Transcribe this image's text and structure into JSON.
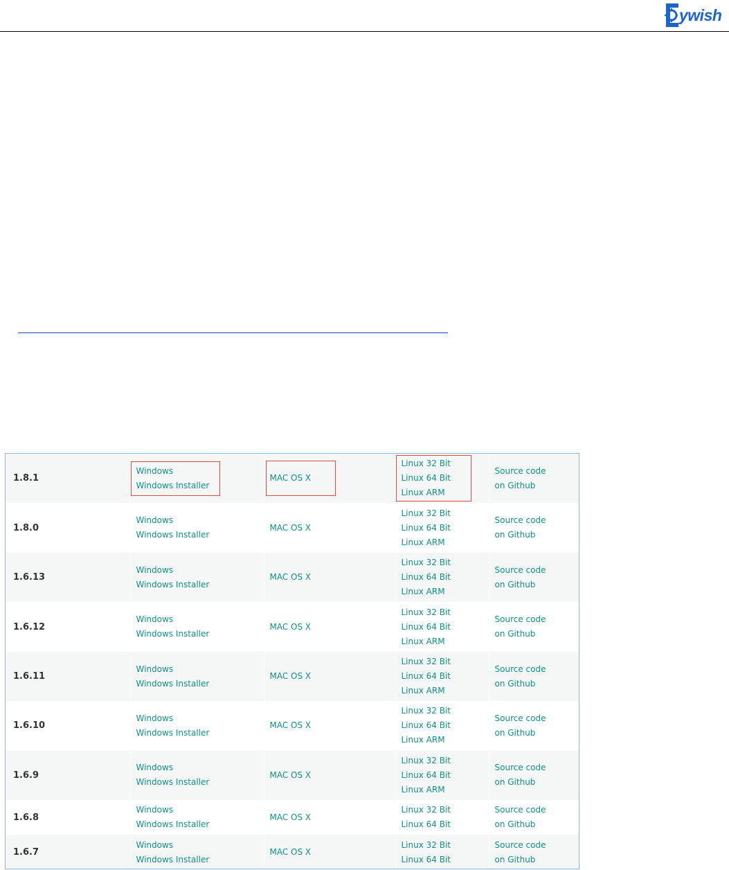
{
  "logo": {
    "text": "ywish"
  },
  "releases": [
    {
      "version": "1.8.1",
      "windows": [
        "Windows",
        "Windows Installer"
      ],
      "mac": "MAC OS X",
      "linux": [
        "Linux 32 Bit",
        "Linux 64 Bit",
        "Linux ARM"
      ],
      "source": [
        "Source code",
        "on Github"
      ]
    },
    {
      "version": "1.8.0",
      "windows": [
        "Windows",
        "Windows Installer"
      ],
      "mac": "MAC OS X",
      "linux": [
        "Linux 32 Bit",
        "Linux 64 Bit",
        "Linux ARM"
      ],
      "source": [
        "Source code",
        "on Github"
      ]
    },
    {
      "version": "1.6.13",
      "windows": [
        "Windows",
        "Windows Installer"
      ],
      "mac": "MAC OS X",
      "linux": [
        "Linux 32 Bit",
        "Linux 64 Bit",
        "Linux ARM"
      ],
      "source": [
        "Source code",
        "on Github"
      ]
    },
    {
      "version": "1.6.12",
      "windows": [
        "Windows",
        "Windows Installer"
      ],
      "mac": "MAC OS X",
      "linux": [
        "Linux 32 Bit",
        "Linux 64 Bit",
        "Linux ARM"
      ],
      "source": [
        "Source code",
        "on Github"
      ]
    },
    {
      "version": "1.6.11",
      "windows": [
        "Windows",
        "Windows Installer"
      ],
      "mac": "MAC OS X",
      "linux": [
        "Linux 32 Bit",
        "Linux 64 Bit",
        "Linux ARM"
      ],
      "source": [
        "Source code",
        "on Github"
      ]
    },
    {
      "version": "1.6.10",
      "windows": [
        "Windows",
        "Windows Installer"
      ],
      "mac": "MAC OS X",
      "linux": [
        "Linux 32 Bit",
        "Linux 64 Bit",
        "Linux ARM"
      ],
      "source": [
        "Source code",
        "on Github"
      ]
    },
    {
      "version": "1.6.9",
      "windows": [
        "Windows",
        "Windows Installer"
      ],
      "mac": "MAC OS X",
      "linux": [
        "Linux 32 Bit",
        "Linux 64 Bit",
        "Linux ARM"
      ],
      "source": [
        "Source code",
        "on Github"
      ]
    },
    {
      "version": "1.6.8",
      "windows": [
        "Windows",
        "Windows Installer"
      ],
      "mac": "MAC OS X",
      "linux": [
        "Linux 32 Bit",
        "Linux 64 Bit"
      ],
      "source": [
        "Source code",
        "on Github"
      ]
    },
    {
      "version": "1.6.7",
      "windows": [
        "Windows",
        "Windows Installer"
      ],
      "mac": "MAC OS X",
      "linux": [
        "Linux 32 Bit",
        "Linux 64 Bit"
      ],
      "source": [
        "Source code",
        "on Github"
      ]
    }
  ],
  "colors": {
    "link": "#0f8f86",
    "highlight": "#e0474c",
    "logo": "#1e63c8",
    "row_shade": "#f5f7f7"
  }
}
